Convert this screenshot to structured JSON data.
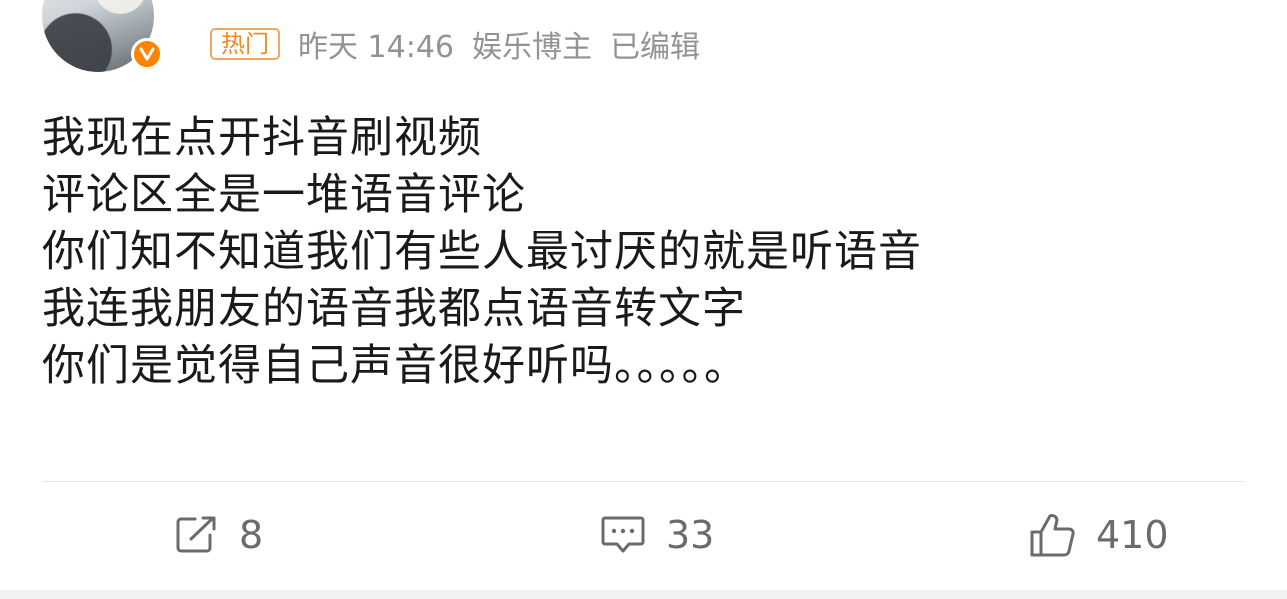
{
  "post": {
    "hot_label": "热门",
    "time": "昨天 14:46",
    "author_role": "娱乐博主",
    "edited": "已编辑",
    "verified_icon": "verified-v-icon",
    "badge_color": "#ff8200",
    "lines": [
      "我现在点开抖音刷视频",
      "评论区全是一堆语音评论",
      "你们知不知道我们有些人最讨厌的就是听语音",
      "我连我朋友的语音我都点语音转文字",
      "你们是觉得自己声音很好听吗。。。。。"
    ]
  },
  "actions": {
    "repost": {
      "icon": "repost-icon",
      "count": "8"
    },
    "comment": {
      "icon": "comment-icon",
      "count": "33"
    },
    "like": {
      "icon": "thumbs-up-icon",
      "count": "410"
    }
  }
}
